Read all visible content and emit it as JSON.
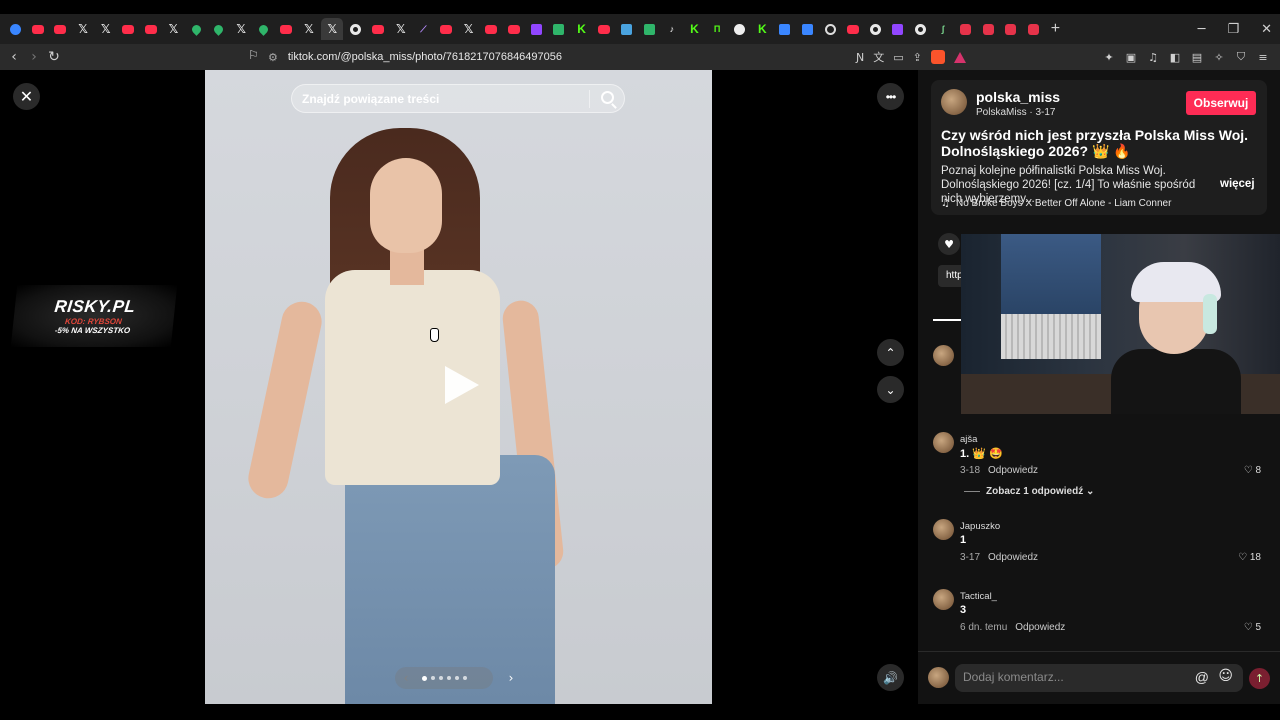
{
  "browser": {
    "tabs": [
      "edge",
      "yt",
      "yt",
      "x",
      "x",
      "yt",
      "yt",
      "x",
      "pin",
      "pin",
      "x",
      "pin",
      "yt",
      "x",
      "x",
      "g",
      "yt",
      "x",
      "feather",
      "yt",
      "x",
      "yt",
      "yt",
      "tw",
      "cal",
      "kick",
      "yt",
      "chart",
      "cal",
      "tiktok",
      "kick",
      "tt",
      "rec",
      "kick",
      "blue",
      "blue",
      "circ",
      "yt",
      "g",
      "tw",
      "g",
      "leaf",
      "red",
      "red",
      "puzzle",
      "red"
    ],
    "new_tab": "+",
    "url": "tiktok.com/@polska_miss/photo/7618217076846497056"
  },
  "viewer": {
    "search_placeholder": "Znajdź powiązane treści",
    "ad": {
      "brand": "RISKY.PL",
      "code": "KOD: RYBSON",
      "promo": "-5% NA WSZYSTKO"
    },
    "slides_total": 6,
    "slide_current": 1
  },
  "post": {
    "username": "polska_miss",
    "display_name": "PolskaMiss",
    "date": "3-17",
    "follow_label": "Obserwuj",
    "title": "Czy wśród nich jest przyszła Polska Miss Woj. Dolnośląskiego 2026? 👑 🔥",
    "description": "Poznaj kolejne półfinalistki Polska Miss Woj. Dolnośląskiego 2026! [cz. 1/4] To właśnie spośród nich wybierzemy...",
    "more_label": "więcej",
    "music": "No Broke Boys X Better Off Alone - Liam Conner",
    "chip": "http"
  },
  "comments": [
    {
      "user": "ajša",
      "text": "1. 👑 🤩",
      "date": "3-18",
      "reply": "Odpowiedz",
      "likes": "8"
    },
    {
      "user": "Japuszko",
      "text": "1",
      "date": "3-17",
      "reply": "Odpowiedz",
      "likes": "18"
    },
    {
      "user": "Tactical_",
      "text": "3",
      "date": "6 dn. temu",
      "reply": "Odpowiedz",
      "likes": "5"
    }
  ],
  "view_replies": "Zobacz 1 odpowiedź",
  "comment_input_placeholder": "Dodaj komentarz...",
  "colors": {
    "accent": "#fe2c55",
    "panel": "#121212",
    "card": "#1e1e1e"
  }
}
